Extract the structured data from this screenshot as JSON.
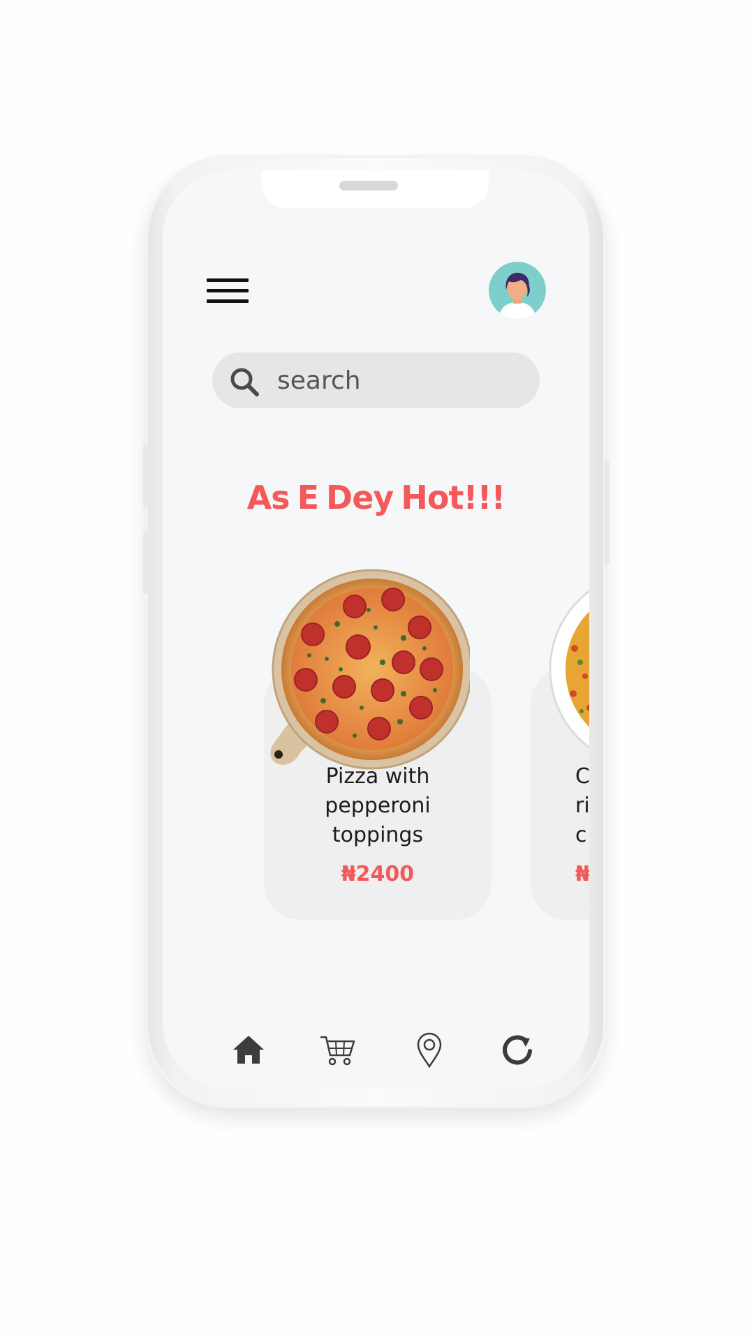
{
  "header": {
    "menu_icon": "hamburger-menu-icon",
    "avatar_icon": "user-avatar"
  },
  "search": {
    "placeholder": "search",
    "icon": "search-icon"
  },
  "headline": "As E Dey Hot!!!",
  "products": [
    {
      "title_lines": [
        "Pizza with",
        "pepperoni",
        "toppings"
      ],
      "price": "₦2400",
      "image": "pepperoni-pizza"
    },
    {
      "title_lines": [
        "C",
        "ri",
        "c"
      ],
      "price": "₦",
      "image": "rice-plate"
    }
  ],
  "bottom_nav": [
    {
      "icon": "home-icon"
    },
    {
      "icon": "cart-icon"
    },
    {
      "icon": "location-pin-icon"
    },
    {
      "icon": "refresh-icon"
    }
  ],
  "colors": {
    "accent": "#f4595a",
    "screen_bg": "#f6f7f8",
    "card_bg": "#efefef",
    "search_bg": "#e6e6e6",
    "avatar_bg": "#7ecfcb"
  }
}
